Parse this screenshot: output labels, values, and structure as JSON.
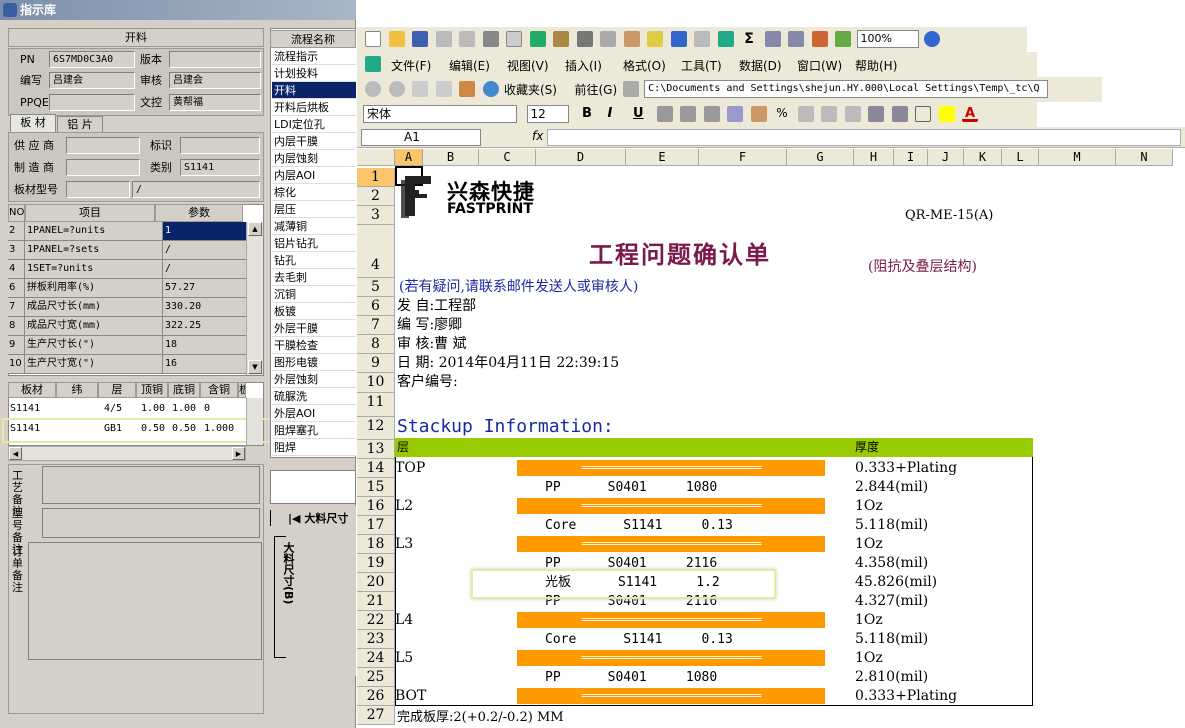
{
  "left_window": {
    "title": "指示库",
    "section_open": "开料",
    "fields": {
      "pn_label": "PN",
      "pn": "6S7MD0C3A0",
      "version_label": "版本",
      "version": "",
      "bianxie_label": "编写",
      "bianxie": "吕建会",
      "shenhe_label": "审核",
      "shenhe": "吕建会",
      "ppqe_label": "PPQE",
      "ppqe": "",
      "wenkong_label": "文控",
      "wenkong": "黄帮福"
    },
    "tabs": [
      "板 材",
      "铝 片"
    ],
    "supplier_label": "供 应 商",
    "supplier": "",
    "mark_label": "标识",
    "mark": "",
    "maker_label": "制 造 商",
    "maker": "",
    "category_label": "类别",
    "category": "S1141",
    "material_label": "板材型号",
    "material": "",
    "material2": "/",
    "param_headers": [
      "NO",
      "项目",
      "参数"
    ],
    "params": [
      {
        "no": "2",
        "item": "1PANEL=?units",
        "val": "1"
      },
      {
        "no": "3",
        "item": "1PANEL=?sets",
        "val": "/"
      },
      {
        "no": "4",
        "item": "1SET=?units",
        "val": "/"
      },
      {
        "no": "6",
        "item": "拼板利用率(%)",
        "val": "57.27"
      },
      {
        "no": "7",
        "item": "成品尺寸长(mm)",
        "val": "330.20"
      },
      {
        "no": "8",
        "item": "成品尺寸宽(mm)",
        "val": "322.25"
      },
      {
        "no": "9",
        "item": "生产尺寸长(\")",
        "val": "18"
      },
      {
        "no": "10",
        "item": "生产尺寸宽(\")",
        "val": "16"
      }
    ],
    "mat_headers": [
      "板材",
      "纬",
      "层",
      "顶铜",
      "底铜",
      "含铜mm",
      "板"
    ],
    "mat_rows": [
      {
        "a": "S1141",
        "b": "",
        "c": "4/5",
        "d": "1.00",
        "e": "1.00",
        "f": "0"
      },
      {
        "a": "S1141",
        "b": "",
        "c": "GB1",
        "d": "0.50",
        "e": "0.50",
        "f": "1.000"
      }
    ],
    "remark1": "工艺备注",
    "remark2": "型号备注",
    "remark3": "订单备注",
    "flow_header": "流程名称",
    "flow": [
      "流程指示",
      "计划投料",
      "开料",
      "开料后烘板",
      "LDI定位孔",
      "内层干膜",
      "内层蚀刻",
      "内层AOI",
      "棕化",
      "层压",
      "减薄铜",
      "铝片钻孔",
      "钻孔",
      "去毛刺",
      "沉铜",
      "板镀",
      "外层干膜",
      "干膜检查",
      "图形电镀",
      "外层蚀刻",
      "硫脲洗",
      "外层AOI",
      "阻焊塞孔",
      "阻焊"
    ],
    "flow_selected": 2,
    "dim_w": "大料尺寸",
    "dim_h": "大料尺寸(B)"
  },
  "excel": {
    "menus": [
      "文件(F)",
      "编辑(E)",
      "视图(V)",
      "插入(I)",
      "格式(O)",
      "工具(T)",
      "数据(D)",
      "窗口(W)",
      "帮助(H)"
    ],
    "zoom": "100%",
    "favorites": "收藏夹(S)",
    "goto": "前往(G)",
    "path": "C:\\Documents and Settings\\shejun.HY.000\\Local Settings\\Temp\\_tc\\Q",
    "font": "宋体",
    "size": "12",
    "bold": "B",
    "italic": "I",
    "underline": "U",
    "cellref": "A1",
    "fx": "fx",
    "columns": [
      "A",
      "B",
      "C",
      "D",
      "E",
      "F",
      "G",
      "H",
      "I",
      "J",
      "K",
      "L",
      "M",
      "N"
    ],
    "rows": [
      "1",
      "2",
      "3",
      "4",
      "5",
      "6",
      "7",
      "8",
      "9",
      "10",
      "11",
      "12",
      "13",
      "14",
      "15",
      "16",
      "17",
      "18",
      "19",
      "20",
      "21",
      "22",
      "23",
      "24",
      "25",
      "26",
      "27"
    ],
    "logo_cn": "兴森快捷",
    "logo_en": "FASTPRINT",
    "doc_code": "QR-ME-15(A)",
    "title": "工程问题确认单",
    "subtitle": "(阻抗及叠层结构)",
    "note": "(若有疑问,请联系邮件发送人或审核人)",
    "from": "发    自:工程部",
    "writer": "编    写:廖卿",
    "reviewer": "审    核:曹  斌",
    "date": "日    期: 2014年04月11日 22:39:15",
    "customer": "客户编号:",
    "stackup_title": "Stackup Information:",
    "stack_header_layer": "层",
    "stack_header_thick": "厚度",
    "bar": "================================",
    "stack": [
      {
        "layer": "TOP",
        "desc": "",
        "thick": "0.333+Plating",
        "bar": true
      },
      {
        "layer": "",
        "desc": "PP      S0401     1080",
        "thick": "2.844(mil)",
        "bar": false
      },
      {
        "layer": "L2",
        "desc": "",
        "thick": "1Oz",
        "bar": true
      },
      {
        "layer": "",
        "desc": "Core      S1141     0.13",
        "thick": "5.118(mil)",
        "bar": false
      },
      {
        "layer": "L3",
        "desc": "",
        "thick": "1Oz",
        "bar": true
      },
      {
        "layer": "",
        "desc": "PP      S0401     2116",
        "thick": "4.358(mil)",
        "bar": false
      },
      {
        "layer": "",
        "desc": "光板      S1141     1.2",
        "thick": "45.826(mil)",
        "bar": false
      },
      {
        "layer": "",
        "desc": "PP      S0401     2116",
        "thick": "4.327(mil)",
        "bar": false
      },
      {
        "layer": "L4",
        "desc": "",
        "thick": "1Oz",
        "bar": true
      },
      {
        "layer": "",
        "desc": "Core      S1141     0.13",
        "thick": "5.118(mil)",
        "bar": false
      },
      {
        "layer": "L5",
        "desc": "",
        "thick": "1Oz",
        "bar": true
      },
      {
        "layer": "",
        "desc": "PP      S0401     1080",
        "thick": "2.810(mil)",
        "bar": false
      },
      {
        "layer": "BOT",
        "desc": "",
        "thick": "0.333+Plating",
        "bar": true
      }
    ],
    "finish": "完成板厚:2(+0.2/-0.2) MM"
  }
}
